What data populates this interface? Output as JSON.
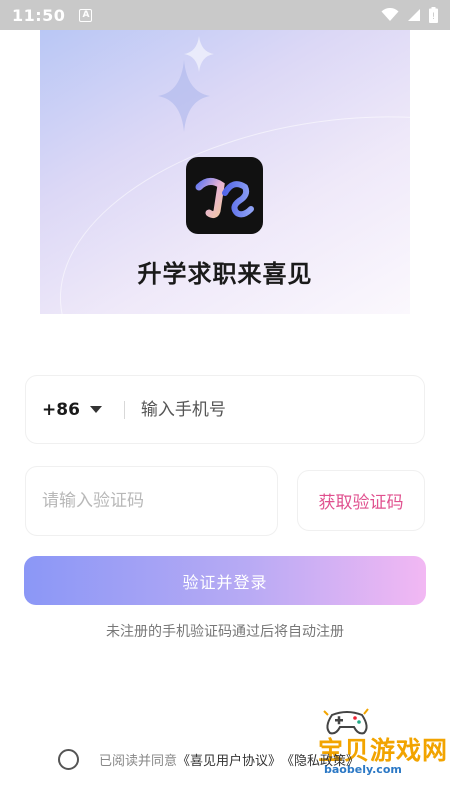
{
  "status_bar": {
    "time": "11:50",
    "notification_glyph": "A",
    "icons": [
      "wifi-icon",
      "signal-icon",
      "battery-icon"
    ]
  },
  "app": {
    "name": "升学求职来喜见",
    "logo_icon": "app-logo-icon"
  },
  "phone": {
    "country_code": "+86",
    "placeholder": "输入手机号",
    "value": ""
  },
  "verification": {
    "placeholder": "请输入验证码",
    "value": "",
    "get_code_label": "获取验证码"
  },
  "login": {
    "button_label": "验证并登录",
    "hint": "未注册的手机验证码通过后将自动注册"
  },
  "agreement": {
    "checked": false,
    "prefix": "已阅读并同意",
    "user_agreement": "《喜见用户协议》",
    "privacy_policy": "《隐私政策》"
  },
  "watermark": {
    "text": "宝贝游戏网",
    "url": "baobely.com"
  },
  "colors": {
    "accent_pink": "#e0518f",
    "button_gradient_start": "#8b97f6",
    "button_gradient_end": "#f2b8f3",
    "status_bar": "#c9c9c9"
  }
}
